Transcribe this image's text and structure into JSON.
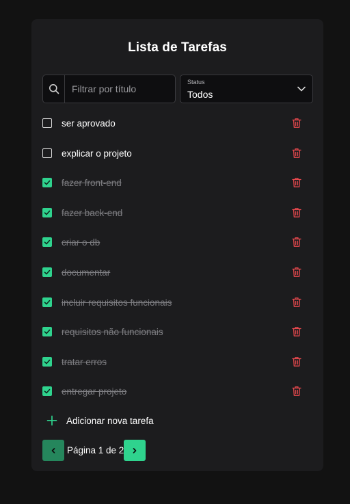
{
  "title": "Lista de Tarefas",
  "search": {
    "placeholder": "Filtrar por título",
    "value": "",
    "icon": "search-icon"
  },
  "status_filter": {
    "label": "Status",
    "value": "Todos",
    "icon": "chevron-down-icon"
  },
  "tasks": [
    {
      "label": "ser aprovado",
      "done": false
    },
    {
      "label": "explicar o projeto",
      "done": false
    },
    {
      "label": "fazer front-end",
      "done": true
    },
    {
      "label": "fazer back-end",
      "done": true
    },
    {
      "label": "criar o db",
      "done": true
    },
    {
      "label": "documentar",
      "done": true
    },
    {
      "label": "incluir requisitos funcionais",
      "done": true
    },
    {
      "label": "requisitos não funcionais",
      "done": true
    },
    {
      "label": "tratar erros",
      "done": true
    },
    {
      "label": "entregar projeto",
      "done": true
    }
  ],
  "add_task": {
    "label": "Adicionar nova tarefa",
    "icon": "plus-icon"
  },
  "pagination": {
    "text": "Página 1 de 2",
    "current": 1,
    "total": 2
  },
  "colors": {
    "accent": "#2fd38e",
    "accent_dark": "#25865c",
    "danger": "#e5484d",
    "background": "#121212",
    "card": "#1c1c1e"
  }
}
